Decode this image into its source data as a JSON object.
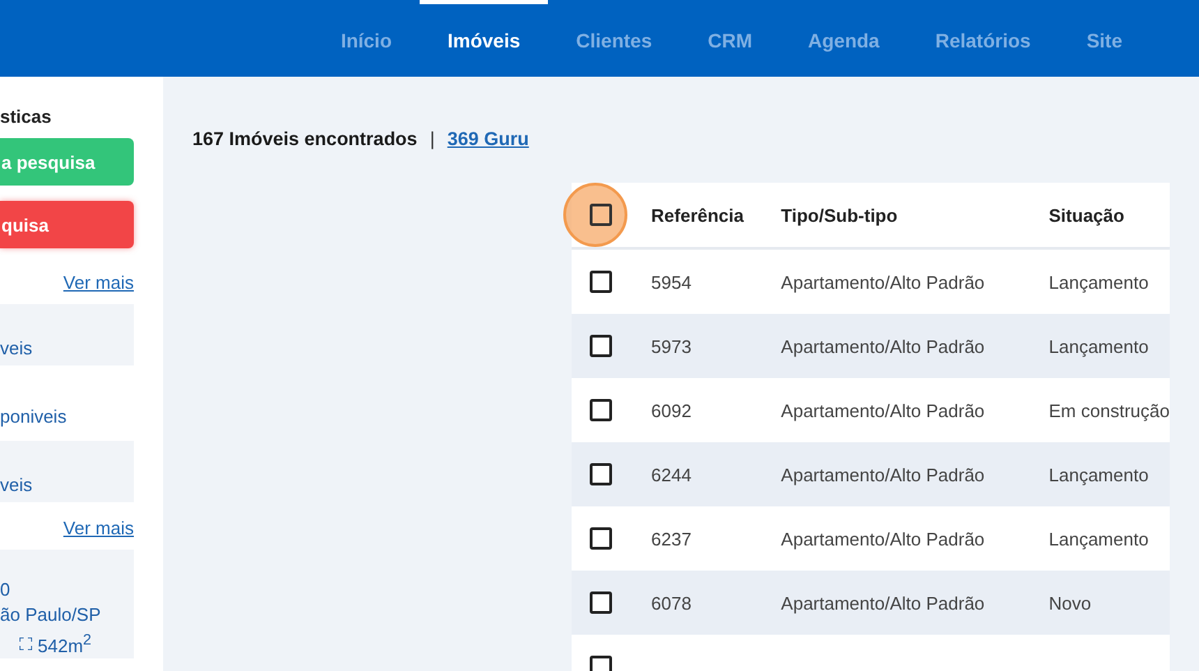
{
  "nav": {
    "items": [
      {
        "label": "Início",
        "selected": false
      },
      {
        "label": "Imóveis",
        "selected": true
      },
      {
        "label": "Clientes",
        "selected": false
      },
      {
        "label": "CRM",
        "selected": false
      },
      {
        "label": "Agenda",
        "selected": false
      },
      {
        "label": "Relatórios",
        "selected": false
      },
      {
        "label": "Site",
        "selected": false
      }
    ]
  },
  "sidebar": {
    "title": "sticas",
    "buttons": [
      {
        "label": "a pesquisa",
        "kind": "save"
      },
      {
        "label": "quisa",
        "kind": "clear"
      }
    ],
    "sections": [
      {
        "items": [
          {
            "label": "veis",
            "shaded": true
          },
          {
            "label": "poniveis",
            "shaded": false
          },
          {
            "label": "veis",
            "shaded": true
          }
        ],
        "more": "Ver mais"
      },
      {
        "card": {
          "lines": [
            "0",
            "ão Paulo/SP"
          ],
          "area": "542m$^{2}$"
        },
        "more": "Ver mais"
      }
    ]
  },
  "results": {
    "count": "167 Imóveis encontrados",
    "separator": "|",
    "link": "369 Guru"
  },
  "table": {
    "header_checked": false,
    "columns": [
      "Referência",
      "Tipo/Sub-tipo",
      "Situação"
    ],
    "rows": [
      {
        "checked": false,
        "cells": [
          "5954",
          "Apartamento/Alto Padrão",
          "Lançamento"
        ]
      },
      {
        "checked": false,
        "cells": [
          "5973",
          "Apartamento/Alto Padrão",
          "Lançamento"
        ]
      },
      {
        "checked": false,
        "cells": [
          "6092",
          "Apartamento/Alto Padrão",
          "Em construção"
        ]
      },
      {
        "checked": false,
        "cells": [
          "6244",
          "Apartamento/Alto Padrão",
          "Lançamento"
        ]
      },
      {
        "checked": false,
        "cells": [
          "6237",
          "Apartamento/Alto Padrão",
          "Lançamento"
        ]
      },
      {
        "checked": false,
        "cells": [
          "6078",
          "Apartamento/Alto Padrão",
          "Novo"
        ]
      },
      {
        "checked": false,
        "cells": []
      }
    ]
  }
}
